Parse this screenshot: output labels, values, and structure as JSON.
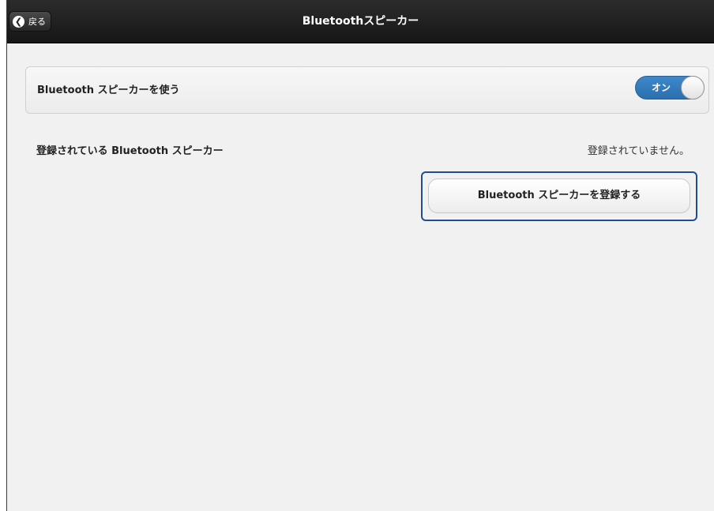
{
  "header": {
    "title": "Bluetoothスピーカー",
    "back_label": "戻る"
  },
  "setting": {
    "label": "Bluetooth スピーカーを使う",
    "toggle_label": "オン",
    "toggle_on": true
  },
  "registered": {
    "label": "登録されている Bluetooth スピーカー",
    "value": "登録されていません。"
  },
  "register_button": {
    "label": "Bluetooth スピーカーを登録する"
  },
  "colors": {
    "header_bg": "#1e1e1e",
    "toggle_accent": "#3479bb",
    "highlight_border": "#1f4f8f",
    "page_bg": "#f1f1f1"
  }
}
